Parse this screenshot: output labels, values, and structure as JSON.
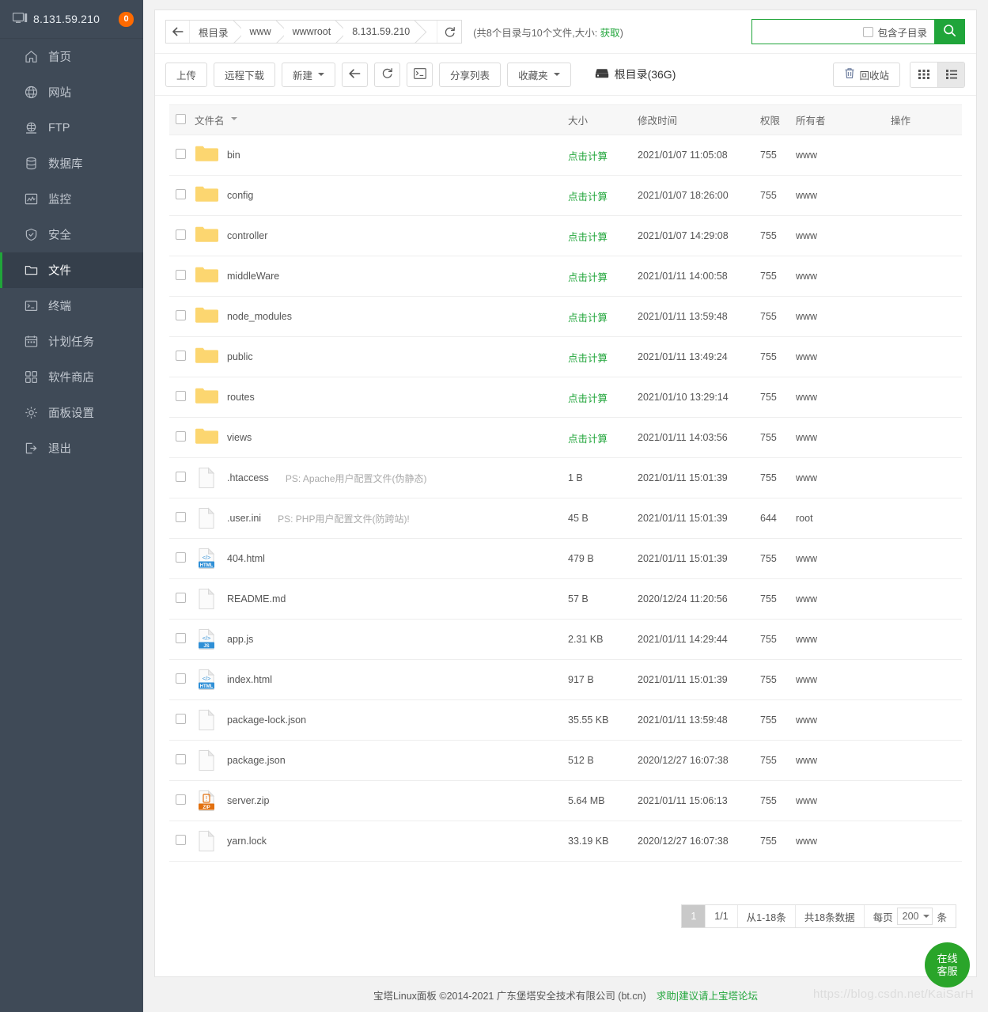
{
  "sidebar": {
    "server_ip": "8.131.59.210",
    "badge": "0",
    "items": [
      {
        "label": "首页",
        "icon": "home-icon"
      },
      {
        "label": "网站",
        "icon": "globe-icon"
      },
      {
        "label": "FTP",
        "icon": "ftp-icon"
      },
      {
        "label": "数据库",
        "icon": "database-icon"
      },
      {
        "label": "监控",
        "icon": "monitor-icon"
      },
      {
        "label": "安全",
        "icon": "shield-icon"
      },
      {
        "label": "文件",
        "icon": "folder-icon"
      },
      {
        "label": "终端",
        "icon": "terminal-icon"
      },
      {
        "label": "计划任务",
        "icon": "calendar-icon"
      },
      {
        "label": "软件商店",
        "icon": "apps-icon"
      },
      {
        "label": "面板设置",
        "icon": "gear-icon"
      },
      {
        "label": "退出",
        "icon": "logout-icon"
      }
    ],
    "active_index": 6
  },
  "pathbar": {
    "back_icon": "arrow-left-icon",
    "crumbs": [
      "根目录",
      "www",
      "wwwroot",
      "8.131.59.210"
    ],
    "refresh_icon": "refresh-icon",
    "dir_info_prefix": "(共8个目录与10个文件,大小: ",
    "dir_info_link": "获取",
    "dir_info_suffix": ")",
    "search_value": "",
    "search_placeholder": "",
    "include_subdir_label": "包含子目录",
    "search_icon": "search-icon"
  },
  "toolbar": {
    "upload": "上传",
    "remote_download": "远程下载",
    "new": "新建",
    "back_icon": "arrow-left-icon",
    "refresh_icon": "refresh-icon",
    "terminal_icon": "terminal-icon",
    "share_list": "分享列表",
    "favorites": "收藏夹",
    "disk_icon": "disk-icon",
    "disk_label": "根目录(36G)",
    "recycle_icon": "trash-icon",
    "recycle_bin": "回收站",
    "view_grid_icon": "grid-view-icon",
    "view_list_icon": "list-view-icon",
    "active_view": "list"
  },
  "table": {
    "columns": {
      "name": "文件名",
      "size": "大小",
      "mtime": "修改时间",
      "perm": "权限",
      "owner": "所有者",
      "action": "操作"
    },
    "calc_label": "点击计算",
    "rows": [
      {
        "name": "bin",
        "kind": "folder",
        "ps": "",
        "size": "点击计算",
        "is_calc": true,
        "mtime": "2021/01/07 11:05:08",
        "perm": "755",
        "owner": "www"
      },
      {
        "name": "config",
        "kind": "folder",
        "ps": "",
        "size": "点击计算",
        "is_calc": true,
        "mtime": "2021/01/07 18:26:00",
        "perm": "755",
        "owner": "www"
      },
      {
        "name": "controller",
        "kind": "folder",
        "ps": "",
        "size": "点击计算",
        "is_calc": true,
        "mtime": "2021/01/07 14:29:08",
        "perm": "755",
        "owner": "www"
      },
      {
        "name": "middleWare",
        "kind": "folder",
        "ps": "",
        "size": "点击计算",
        "is_calc": true,
        "mtime": "2021/01/11 14:00:58",
        "perm": "755",
        "owner": "www"
      },
      {
        "name": "node_modules",
        "kind": "folder",
        "ps": "",
        "size": "点击计算",
        "is_calc": true,
        "mtime": "2021/01/11 13:59:48",
        "perm": "755",
        "owner": "www"
      },
      {
        "name": "public",
        "kind": "folder",
        "ps": "",
        "size": "点击计算",
        "is_calc": true,
        "mtime": "2021/01/11 13:49:24",
        "perm": "755",
        "owner": "www"
      },
      {
        "name": "routes",
        "kind": "folder",
        "ps": "",
        "size": "点击计算",
        "is_calc": true,
        "mtime": "2021/01/10 13:29:14",
        "perm": "755",
        "owner": "www"
      },
      {
        "name": "views",
        "kind": "folder",
        "ps": "",
        "size": "点击计算",
        "is_calc": true,
        "mtime": "2021/01/11 14:03:56",
        "perm": "755",
        "owner": "www"
      },
      {
        "name": ".htaccess",
        "kind": "file",
        "ps": "PS: Apache用户配置文件(伪静态)",
        "size": "1 B",
        "is_calc": false,
        "mtime": "2021/01/11 15:01:39",
        "perm": "755",
        "owner": "www"
      },
      {
        "name": ".user.ini",
        "kind": "file",
        "ps": "PS: PHP用户配置文件(防跨站)!",
        "size": "45 B",
        "is_calc": false,
        "mtime": "2021/01/11 15:01:39",
        "perm": "644",
        "owner": "root"
      },
      {
        "name": "404.html",
        "kind": "html",
        "ps": "",
        "size": "479 B",
        "is_calc": false,
        "mtime": "2021/01/11 15:01:39",
        "perm": "755",
        "owner": "www"
      },
      {
        "name": "README.md",
        "kind": "file",
        "ps": "",
        "size": "57 B",
        "is_calc": false,
        "mtime": "2020/12/24 11:20:56",
        "perm": "755",
        "owner": "www"
      },
      {
        "name": "app.js",
        "kind": "js",
        "ps": "",
        "size": "2.31 KB",
        "is_calc": false,
        "mtime": "2021/01/11 14:29:44",
        "perm": "755",
        "owner": "www"
      },
      {
        "name": "index.html",
        "kind": "html",
        "ps": "",
        "size": "917 B",
        "is_calc": false,
        "mtime": "2021/01/11 15:01:39",
        "perm": "755",
        "owner": "www"
      },
      {
        "name": "package-lock.json",
        "kind": "file",
        "ps": "",
        "size": "35.55 KB",
        "is_calc": false,
        "mtime": "2021/01/11 13:59:48",
        "perm": "755",
        "owner": "www"
      },
      {
        "name": "package.json",
        "kind": "file",
        "ps": "",
        "size": "512 B",
        "is_calc": false,
        "mtime": "2020/12/27 16:07:38",
        "perm": "755",
        "owner": "www"
      },
      {
        "name": "server.zip",
        "kind": "zip",
        "ps": "",
        "size": "5.64 MB",
        "is_calc": false,
        "mtime": "2021/01/11 15:06:13",
        "perm": "755",
        "owner": "www"
      },
      {
        "name": "yarn.lock",
        "kind": "file",
        "ps": "",
        "size": "33.19 KB",
        "is_calc": false,
        "mtime": "2020/12/27 16:07:38",
        "perm": "755",
        "owner": "www"
      }
    ]
  },
  "pagination": {
    "current_page": "1",
    "page_of": "1/1",
    "range": "从1-18条",
    "total": "共18条数据",
    "per_page_prefix": "每页",
    "per_page_value": "200",
    "per_page_suffix": "条"
  },
  "footer": {
    "copyright": "宝塔Linux面板 ©2014-2021 广东堡塔安全技术有限公司 (bt.cn)",
    "help_link": "求助|建议请上宝塔论坛"
  },
  "floating": {
    "kefu_line1": "在线",
    "kefu_line2": "客服",
    "watermark": "https://blog.csdn.net/KaiSarH"
  },
  "colors": {
    "sidebar_bg": "#3f4a57",
    "sidebar_active": "#353f4b",
    "accent_green": "#20a53a",
    "badge_orange": "#ff6a00",
    "folder_yellow": "#fcd670"
  }
}
